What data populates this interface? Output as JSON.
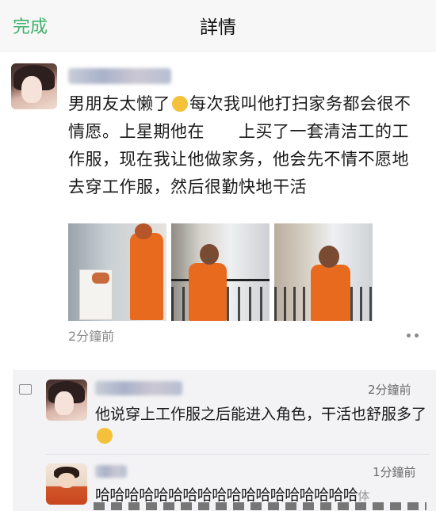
{
  "header": {
    "done_label": "完成",
    "title": "詳情"
  },
  "post": {
    "text_part1": "男朋友太懒了",
    "text_part2": "每次我叫他打扫家务都会很不情愿。上星期他在　　上买了一套清洁工的工作服，现在我让他做家务，他会先不情不愿地去穿工作服，然后很勤快地干活",
    "time": "2分鐘前",
    "photo_count": 3
  },
  "comments": [
    {
      "time": "2分鐘前",
      "text": "他说穿上工作服之后能进入角色，干活也舒服多了"
    },
    {
      "time": "1分鐘前",
      "text": "哈哈哈哈哈哈哈哈哈哈哈哈哈哈哈哈哈哈",
      "trailing": "体"
    }
  ],
  "colors": {
    "accent": "#3fb26a",
    "uniform": "#e86a1f"
  }
}
